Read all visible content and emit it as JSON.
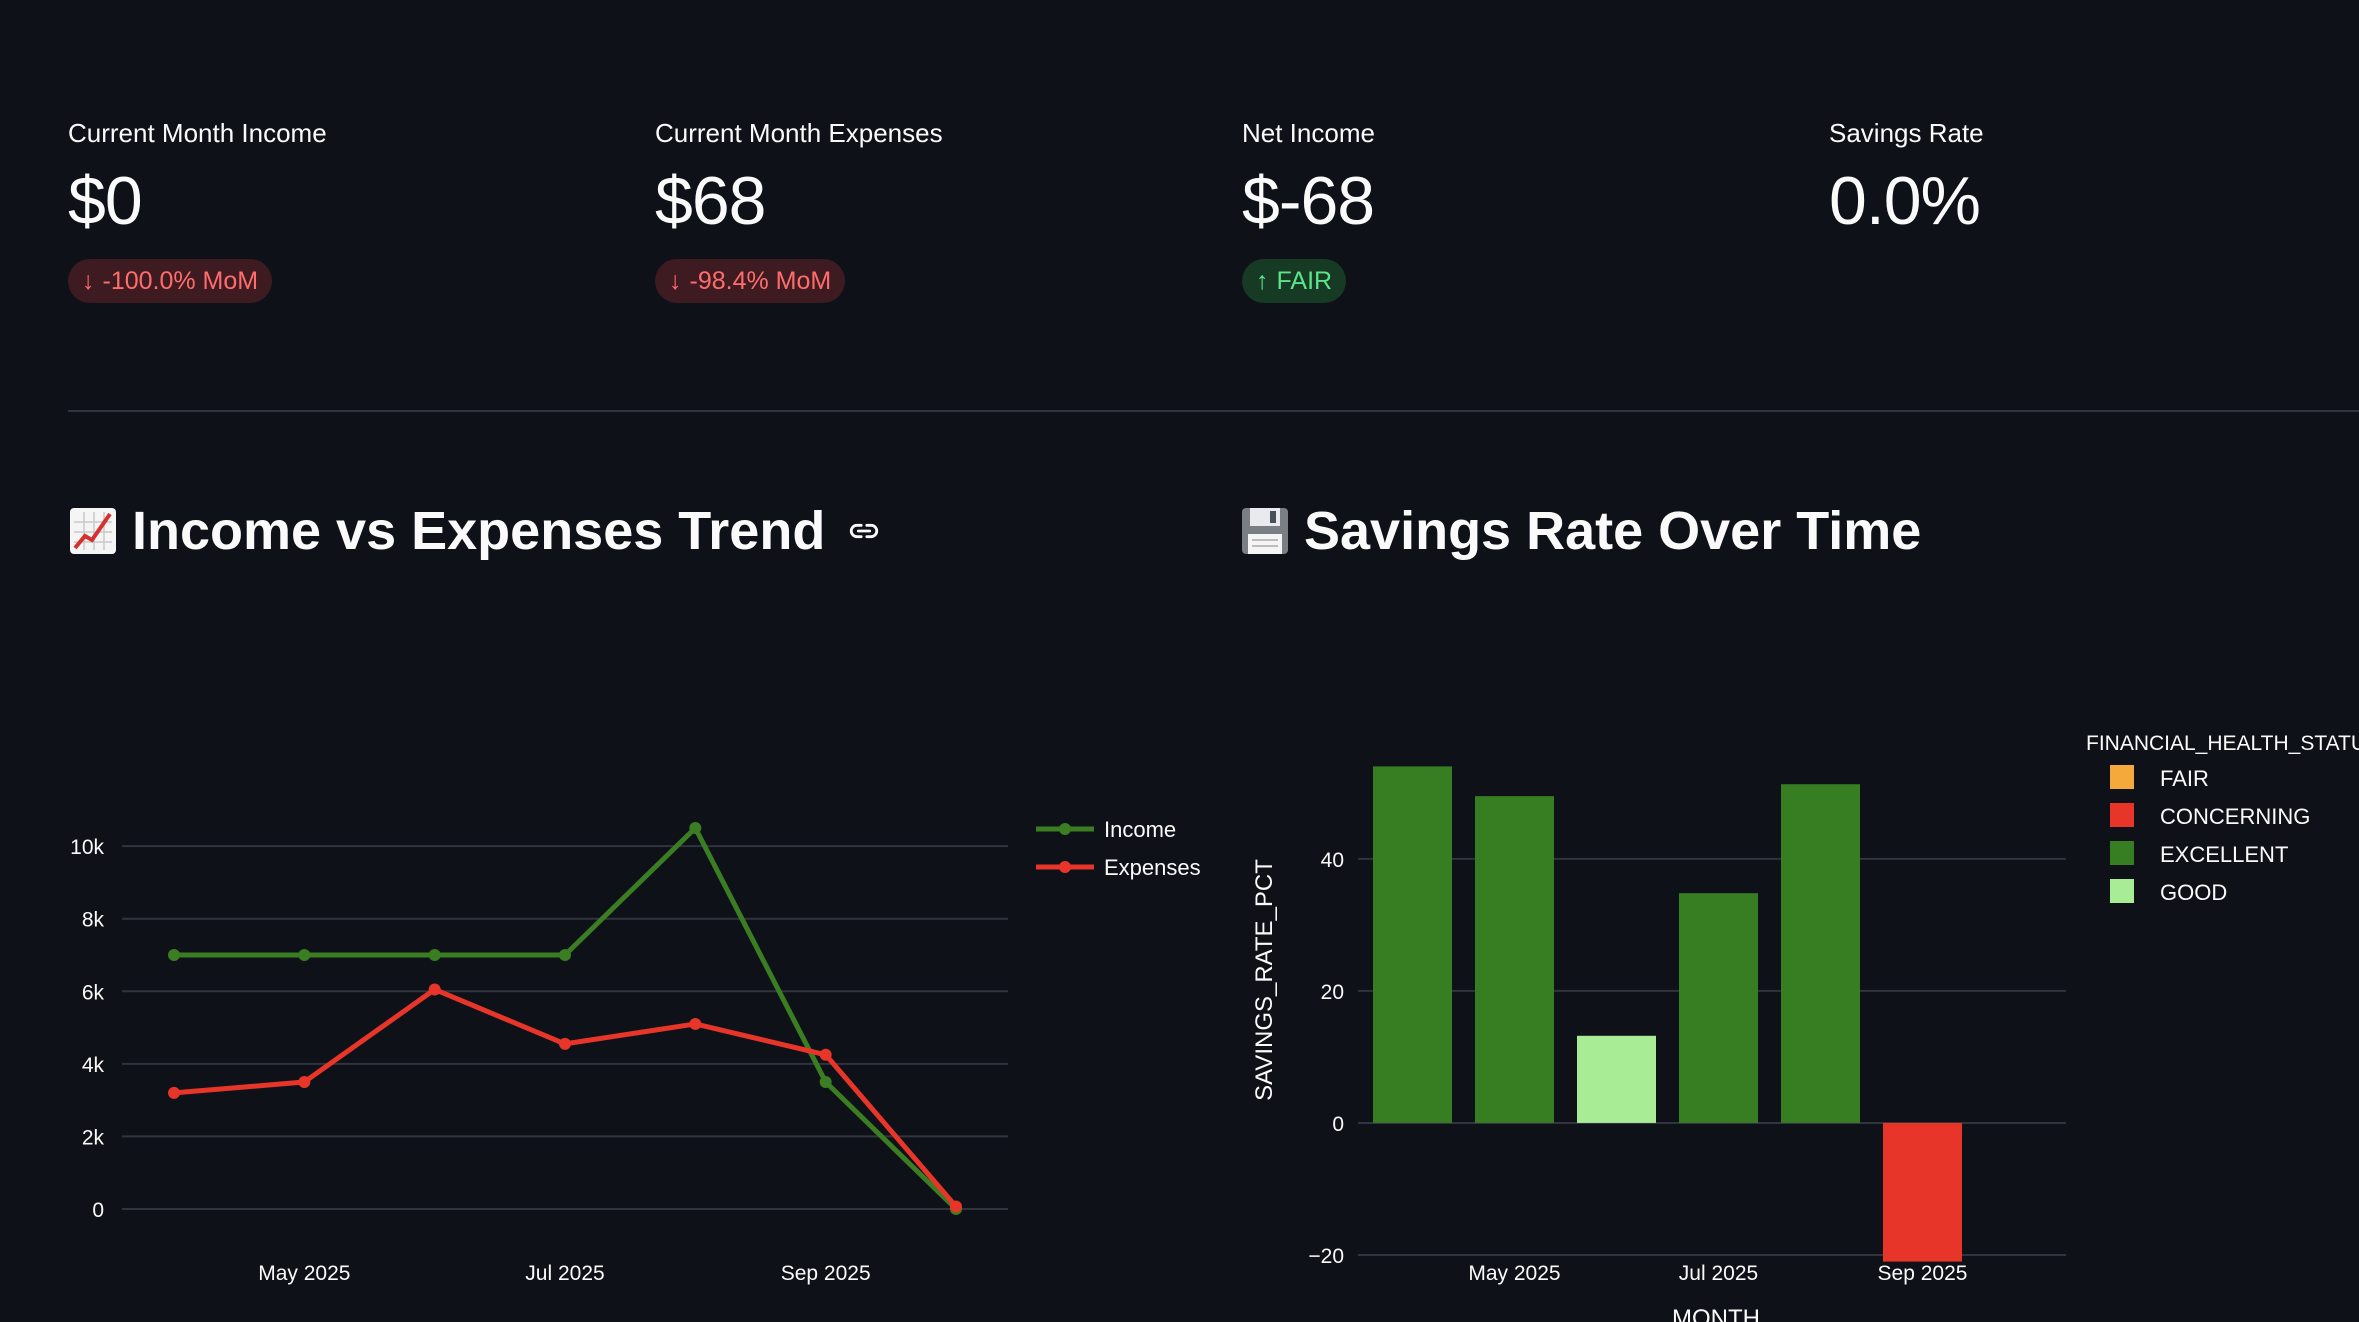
{
  "metrics": [
    {
      "label": "Current Month Income",
      "value": "$0",
      "delta": "-100.0% MoM",
      "direction": "down"
    },
    {
      "label": "Current Month Expenses",
      "value": "$68",
      "delta": "-98.4% MoM",
      "direction": "down"
    },
    {
      "label": "Net Income",
      "value": "$-68",
      "delta": "FAIR",
      "direction": "up"
    },
    {
      "label": "Savings Rate",
      "value": "0.0%",
      "delta": "",
      "direction": ""
    }
  ],
  "sections": {
    "trend_title": "Income vs Expenses Trend",
    "trend_icon": "chart-increasing-emoji-icon",
    "savings_title": "Savings Rate Over Time",
    "savings_icon": "floppy-disk-emoji-icon"
  },
  "colors": {
    "income": "#3a7d22",
    "expenses": "#e8352a",
    "fair": "#f4a93a",
    "concerning": "#e8352a",
    "excellent": "#377d22",
    "good": "#a8ec96",
    "delta_down": "#ff6c6c",
    "delta_up": "#5ce488"
  },
  "chart_data": [
    {
      "type": "line",
      "title": "",
      "x": [
        "2025-04-01",
        "2025-05-01",
        "2025-06-01",
        "2025-07-01",
        "2025-08-01",
        "2025-09-01",
        "2025-10-01"
      ],
      "xticks": [
        "May 2025",
        "Jul 2025",
        "Sep 2025"
      ],
      "yticks": [
        "0",
        "2k",
        "4k",
        "6k",
        "8k",
        "10k"
      ],
      "ylim": [
        0,
        10500
      ],
      "xlabel": "",
      "ylabel": "",
      "legend_position": "top-right",
      "grid": true,
      "series": [
        {
          "name": "Income",
          "values": [
            7000,
            7000,
            7000,
            7000,
            10500,
            3500,
            0
          ]
        },
        {
          "name": "Expenses",
          "values": [
            3200,
            3500,
            6050,
            4550,
            5100,
            4250,
            68
          ]
        }
      ]
    },
    {
      "type": "bar",
      "title": "",
      "x": [
        "2025-04-01",
        "2025-05-01",
        "2025-06-01",
        "2025-07-01",
        "2025-08-01",
        "2025-09-01"
      ],
      "values": [
        54,
        49.5,
        13.2,
        34.8,
        51.3,
        -21
      ],
      "status": [
        "EXCELLENT",
        "EXCELLENT",
        "GOOD",
        "EXCELLENT",
        "EXCELLENT",
        "CONCERNING"
      ],
      "xticks": [
        "May 2025",
        "Jul 2025",
        "Sep 2025"
      ],
      "yticks": [
        "−20",
        "0",
        "20",
        "40"
      ],
      "ylim": [
        -25,
        58
      ],
      "xlabel": "MONTH",
      "ylabel": "SAVINGS_RATE_PCT",
      "legend_title": "FINANCIAL_HEALTH_STATU",
      "legend": [
        "FAIR",
        "CONCERNING",
        "EXCELLENT",
        "GOOD"
      ],
      "legend_position": "right",
      "grid": true
    }
  ]
}
